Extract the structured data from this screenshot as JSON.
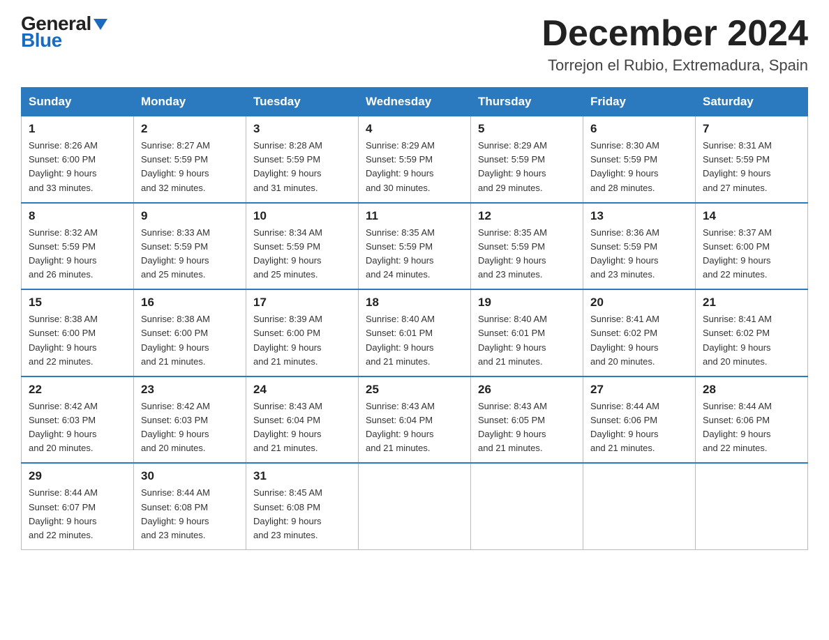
{
  "logo": {
    "top": "General",
    "bottom": "Blue"
  },
  "calendar": {
    "title": "December 2024",
    "subtitle": "Torrejon el Rubio, Extremadura, Spain",
    "days_of_week": [
      "Sunday",
      "Monday",
      "Tuesday",
      "Wednesday",
      "Thursday",
      "Friday",
      "Saturday"
    ],
    "weeks": [
      [
        {
          "day": "1",
          "sunrise": "8:26 AM",
          "sunset": "6:00 PM",
          "daylight": "9 hours and 33 minutes."
        },
        {
          "day": "2",
          "sunrise": "8:27 AM",
          "sunset": "5:59 PM",
          "daylight": "9 hours and 32 minutes."
        },
        {
          "day": "3",
          "sunrise": "8:28 AM",
          "sunset": "5:59 PM",
          "daylight": "9 hours and 31 minutes."
        },
        {
          "day": "4",
          "sunrise": "8:29 AM",
          "sunset": "5:59 PM",
          "daylight": "9 hours and 30 minutes."
        },
        {
          "day": "5",
          "sunrise": "8:29 AM",
          "sunset": "5:59 PM",
          "daylight": "9 hours and 29 minutes."
        },
        {
          "day": "6",
          "sunrise": "8:30 AM",
          "sunset": "5:59 PM",
          "daylight": "9 hours and 28 minutes."
        },
        {
          "day": "7",
          "sunrise": "8:31 AM",
          "sunset": "5:59 PM",
          "daylight": "9 hours and 27 minutes."
        }
      ],
      [
        {
          "day": "8",
          "sunrise": "8:32 AM",
          "sunset": "5:59 PM",
          "daylight": "9 hours and 26 minutes."
        },
        {
          "day": "9",
          "sunrise": "8:33 AM",
          "sunset": "5:59 PM",
          "daylight": "9 hours and 25 minutes."
        },
        {
          "day": "10",
          "sunrise": "8:34 AM",
          "sunset": "5:59 PM",
          "daylight": "9 hours and 25 minutes."
        },
        {
          "day": "11",
          "sunrise": "8:35 AM",
          "sunset": "5:59 PM",
          "daylight": "9 hours and 24 minutes."
        },
        {
          "day": "12",
          "sunrise": "8:35 AM",
          "sunset": "5:59 PM",
          "daylight": "9 hours and 23 minutes."
        },
        {
          "day": "13",
          "sunrise": "8:36 AM",
          "sunset": "5:59 PM",
          "daylight": "9 hours and 23 minutes."
        },
        {
          "day": "14",
          "sunrise": "8:37 AM",
          "sunset": "6:00 PM",
          "daylight": "9 hours and 22 minutes."
        }
      ],
      [
        {
          "day": "15",
          "sunrise": "8:38 AM",
          "sunset": "6:00 PM",
          "daylight": "9 hours and 22 minutes."
        },
        {
          "day": "16",
          "sunrise": "8:38 AM",
          "sunset": "6:00 PM",
          "daylight": "9 hours and 21 minutes."
        },
        {
          "day": "17",
          "sunrise": "8:39 AM",
          "sunset": "6:00 PM",
          "daylight": "9 hours and 21 minutes."
        },
        {
          "day": "18",
          "sunrise": "8:40 AM",
          "sunset": "6:01 PM",
          "daylight": "9 hours and 21 minutes."
        },
        {
          "day": "19",
          "sunrise": "8:40 AM",
          "sunset": "6:01 PM",
          "daylight": "9 hours and 21 minutes."
        },
        {
          "day": "20",
          "sunrise": "8:41 AM",
          "sunset": "6:02 PM",
          "daylight": "9 hours and 20 minutes."
        },
        {
          "day": "21",
          "sunrise": "8:41 AM",
          "sunset": "6:02 PM",
          "daylight": "9 hours and 20 minutes."
        }
      ],
      [
        {
          "day": "22",
          "sunrise": "8:42 AM",
          "sunset": "6:03 PM",
          "daylight": "9 hours and 20 minutes."
        },
        {
          "day": "23",
          "sunrise": "8:42 AM",
          "sunset": "6:03 PM",
          "daylight": "9 hours and 20 minutes."
        },
        {
          "day": "24",
          "sunrise": "8:43 AM",
          "sunset": "6:04 PM",
          "daylight": "9 hours and 21 minutes."
        },
        {
          "day": "25",
          "sunrise": "8:43 AM",
          "sunset": "6:04 PM",
          "daylight": "9 hours and 21 minutes."
        },
        {
          "day": "26",
          "sunrise": "8:43 AM",
          "sunset": "6:05 PM",
          "daylight": "9 hours and 21 minutes."
        },
        {
          "day": "27",
          "sunrise": "8:44 AM",
          "sunset": "6:06 PM",
          "daylight": "9 hours and 21 minutes."
        },
        {
          "day": "28",
          "sunrise": "8:44 AM",
          "sunset": "6:06 PM",
          "daylight": "9 hours and 22 minutes."
        }
      ],
      [
        {
          "day": "29",
          "sunrise": "8:44 AM",
          "sunset": "6:07 PM",
          "daylight": "9 hours and 22 minutes."
        },
        {
          "day": "30",
          "sunrise": "8:44 AM",
          "sunset": "6:08 PM",
          "daylight": "9 hours and 23 minutes."
        },
        {
          "day": "31",
          "sunrise": "8:45 AM",
          "sunset": "6:08 PM",
          "daylight": "9 hours and 23 minutes."
        },
        null,
        null,
        null,
        null
      ]
    ]
  }
}
